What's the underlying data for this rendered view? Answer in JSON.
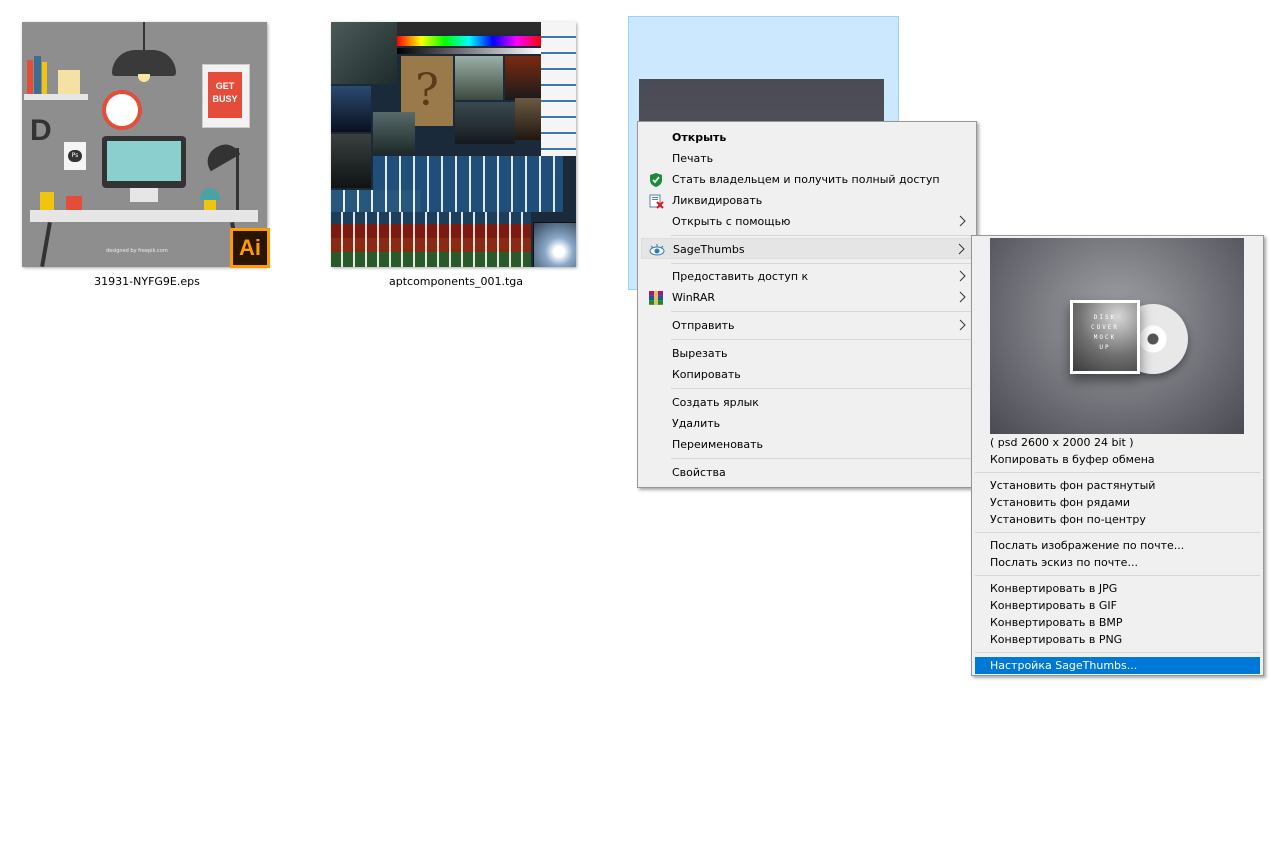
{
  "files": [
    {
      "name": "31931-NYFG9E.eps",
      "badge": "Ai",
      "poster_text": "GET BUSY",
      "letter": "D",
      "ps_tag": "Ps",
      "credit": "designed by freepik.com"
    },
    {
      "name": "aptcomponents_001.tga"
    }
  ],
  "context_menu": {
    "items": [
      {
        "label": "Открыть"
      },
      {
        "label": "Печать"
      },
      {
        "label": "Стать владельцем и получить полный доступ",
        "icon": "shield-icon"
      },
      {
        "label": "Ликвидировать",
        "icon": "unlocker-icon"
      },
      {
        "label": "Открыть с помощью"
      },
      {
        "label": "SageThumbs",
        "icon": "sagethumbs-eye-icon"
      },
      {
        "label": "Предоставить доступ к"
      },
      {
        "label": "WinRAR",
        "icon": "winrar-icon"
      },
      {
        "label": "Отправить"
      },
      {
        "label": "Вырезать"
      },
      {
        "label": "Копировать"
      },
      {
        "label": "Создать ярлык"
      },
      {
        "label": "Удалить"
      },
      {
        "label": "Переименовать"
      },
      {
        "label": "Свойства"
      }
    ]
  },
  "submenu": {
    "preview_caption_lines": [
      "DISK",
      "COVER",
      "MOCK",
      "UP"
    ],
    "info": "( psd 2600 x 2000 24 bit )",
    "copy": "Копировать в буфер обмена",
    "wallpaper": [
      "Установить фон растянутый",
      "Установить фон рядами",
      "Установить фон по-центру"
    ],
    "mail": [
      "Послать изображение по почте...",
      "Послать эскиз по почте..."
    ],
    "convert": [
      "Конвертировать в JPG",
      "Конвертировать в GIF",
      "Конвертировать в BMP",
      "Конвертировать в PNG"
    ],
    "settings": "Настройка SageThumbs..."
  },
  "colors": {
    "selection": "#cce8ff",
    "menu_bg": "#f0f0f0",
    "highlight": "#0078d7",
    "ai_badge": "#ff9a00"
  }
}
